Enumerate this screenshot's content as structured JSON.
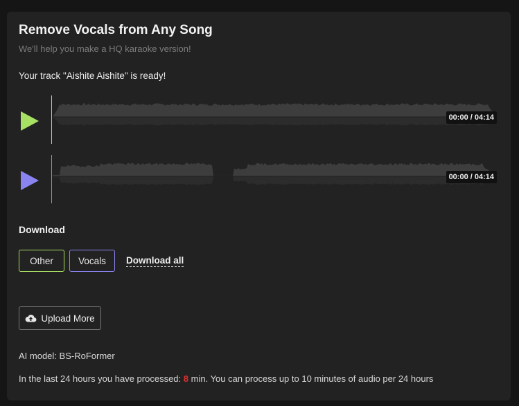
{
  "header": {
    "title": "Remove Vocals from Any Song",
    "subtitle": "We'll help you make a HQ karaoke version!"
  },
  "status": {
    "ready_message": "Your track \"Aishite Aishite\" is ready!"
  },
  "tracks": [
    {
      "id": "other",
      "color": "#a8e063",
      "time": "00:00 / 04:14",
      "play_icon": "play-icon"
    },
    {
      "id": "vocals",
      "color": "#8a84f0",
      "time": "00:00 / 04:14",
      "play_icon": "play-icon"
    }
  ],
  "download": {
    "heading": "Download",
    "other_label": "Other",
    "vocals_label": "Vocals",
    "all_label": "Download all"
  },
  "upload": {
    "label": "Upload More",
    "icon": "cloud-upload-icon"
  },
  "info": {
    "model": "AI model: BS-RoFormer",
    "usage_prefix": "In the last 24 hours you have processed:",
    "minutes": "8",
    "usage_suffix": "min. You can process up to 10 minutes of audio per 24 hours"
  }
}
